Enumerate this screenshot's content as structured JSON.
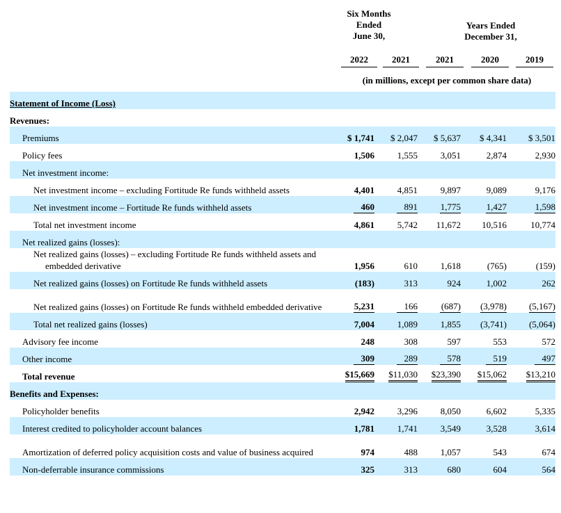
{
  "header": {
    "six_months": [
      "Six Months",
      "Ended",
      "June 30,"
    ],
    "years_ended": [
      "Years Ended",
      "December 31,"
    ],
    "years": [
      "2022",
      "2021",
      "2021",
      "2020",
      "2019"
    ],
    "units": "(in millions, except per common share data)"
  },
  "rows": [
    {
      "label": "Statement of Income (Loss)",
      "style": "section-ul",
      "shade": true,
      "values": null
    },
    {
      "label": "Revenues:",
      "style": "section",
      "shade": false,
      "values": null
    },
    {
      "label": "Premiums",
      "indent": 1,
      "shade": true,
      "values": [
        "$ 1,741",
        "$ 2,047",
        "$ 5,637",
        "$ 4,341",
        "$ 3,501"
      ]
    },
    {
      "label": "Policy fees",
      "indent": 1,
      "shade": false,
      "values": [
        "1,506",
        "1,555",
        "3,051",
        "2,874",
        "2,930"
      ]
    },
    {
      "label": "Net investment income:",
      "indent": 1,
      "shade": true,
      "values": null
    },
    {
      "label": "Net investment income – excluding Fortitude Re funds withheld assets",
      "indent": 2,
      "shade": false,
      "values": [
        "4,401",
        "4,851",
        "9,897",
        "9,089",
        "9,176"
      ]
    },
    {
      "label": "Net investment income – Fortitude Re funds withheld assets",
      "indent": 2,
      "shade": true,
      "underline": true,
      "values": [
        "460",
        "891",
        "1,775",
        "1,427",
        "1,598"
      ]
    },
    {
      "label": "Total net investment income",
      "indent": 2,
      "shade": false,
      "values": [
        "4,861",
        "5,742",
        "11,672",
        "10,516",
        "10,774"
      ]
    },
    {
      "label": "Net realized gains (losses):",
      "indent": 1,
      "shade": true,
      "values": null
    },
    {
      "label": "Net realized gains (losses) – excluding Fortitude Re funds withheld assets and embedded derivative",
      "indent": 2,
      "shade": false,
      "wrap": true,
      "values": [
        "1,956",
        "610",
        "1,618",
        "(765)",
        "(159)"
      ]
    },
    {
      "label": "Net realized gains (losses) on Fortitude Re funds withheld assets",
      "indent": 2,
      "shade": true,
      "values": [
        "(183)",
        "313",
        "924",
        "1,002",
        "262"
      ]
    },
    {
      "label": "Net realized gains (losses) on Fortitude Re funds withheld embedded derivative",
      "indent": 2,
      "shade": false,
      "wrap": true,
      "underline": true,
      "values": [
        "5,231",
        "166",
        "(687)",
        "(3,978)",
        "(5,167)"
      ]
    },
    {
      "label": "Total net realized gains (losses)",
      "indent": 2,
      "shade": true,
      "values": [
        "7,004",
        "1,089",
        "1,855",
        "(3,741)",
        "(5,064)"
      ]
    },
    {
      "label": "Advisory fee income",
      "indent": 1,
      "shade": false,
      "values": [
        "248",
        "308",
        "597",
        "553",
        "572"
      ]
    },
    {
      "label": "Other income",
      "indent": 1,
      "shade": true,
      "underline": true,
      "values": [
        "309",
        "289",
        "578",
        "519",
        "497"
      ]
    },
    {
      "label": "Total revenue",
      "indent": 1,
      "shade": false,
      "bold": true,
      "double": true,
      "values": [
        "$15,669",
        "$11,030",
        "$23,390",
        "$15,062",
        "$13,210"
      ]
    },
    {
      "label": "Benefits and Expenses:",
      "style": "section",
      "shade": true,
      "values": null
    },
    {
      "label": "Policyholder benefits",
      "indent": 1,
      "shade": false,
      "values": [
        "2,942",
        "3,296",
        "8,050",
        "6,602",
        "5,335"
      ]
    },
    {
      "label": "Interest credited to policyholder account balances",
      "indent": 1,
      "shade": true,
      "values": [
        "1,781",
        "1,741",
        "3,549",
        "3,528",
        "3,614"
      ]
    },
    {
      "label": "Amortization of deferred policy acquisition costs and value of business acquired",
      "indent": 1,
      "shade": false,
      "wrap": true,
      "values": [
        "974",
        "488",
        "1,057",
        "543",
        "674"
      ]
    },
    {
      "label": "Non-deferrable insurance commissions",
      "indent": 1,
      "shade": true,
      "values": [
        "325",
        "313",
        "680",
        "604",
        "564"
      ]
    }
  ]
}
